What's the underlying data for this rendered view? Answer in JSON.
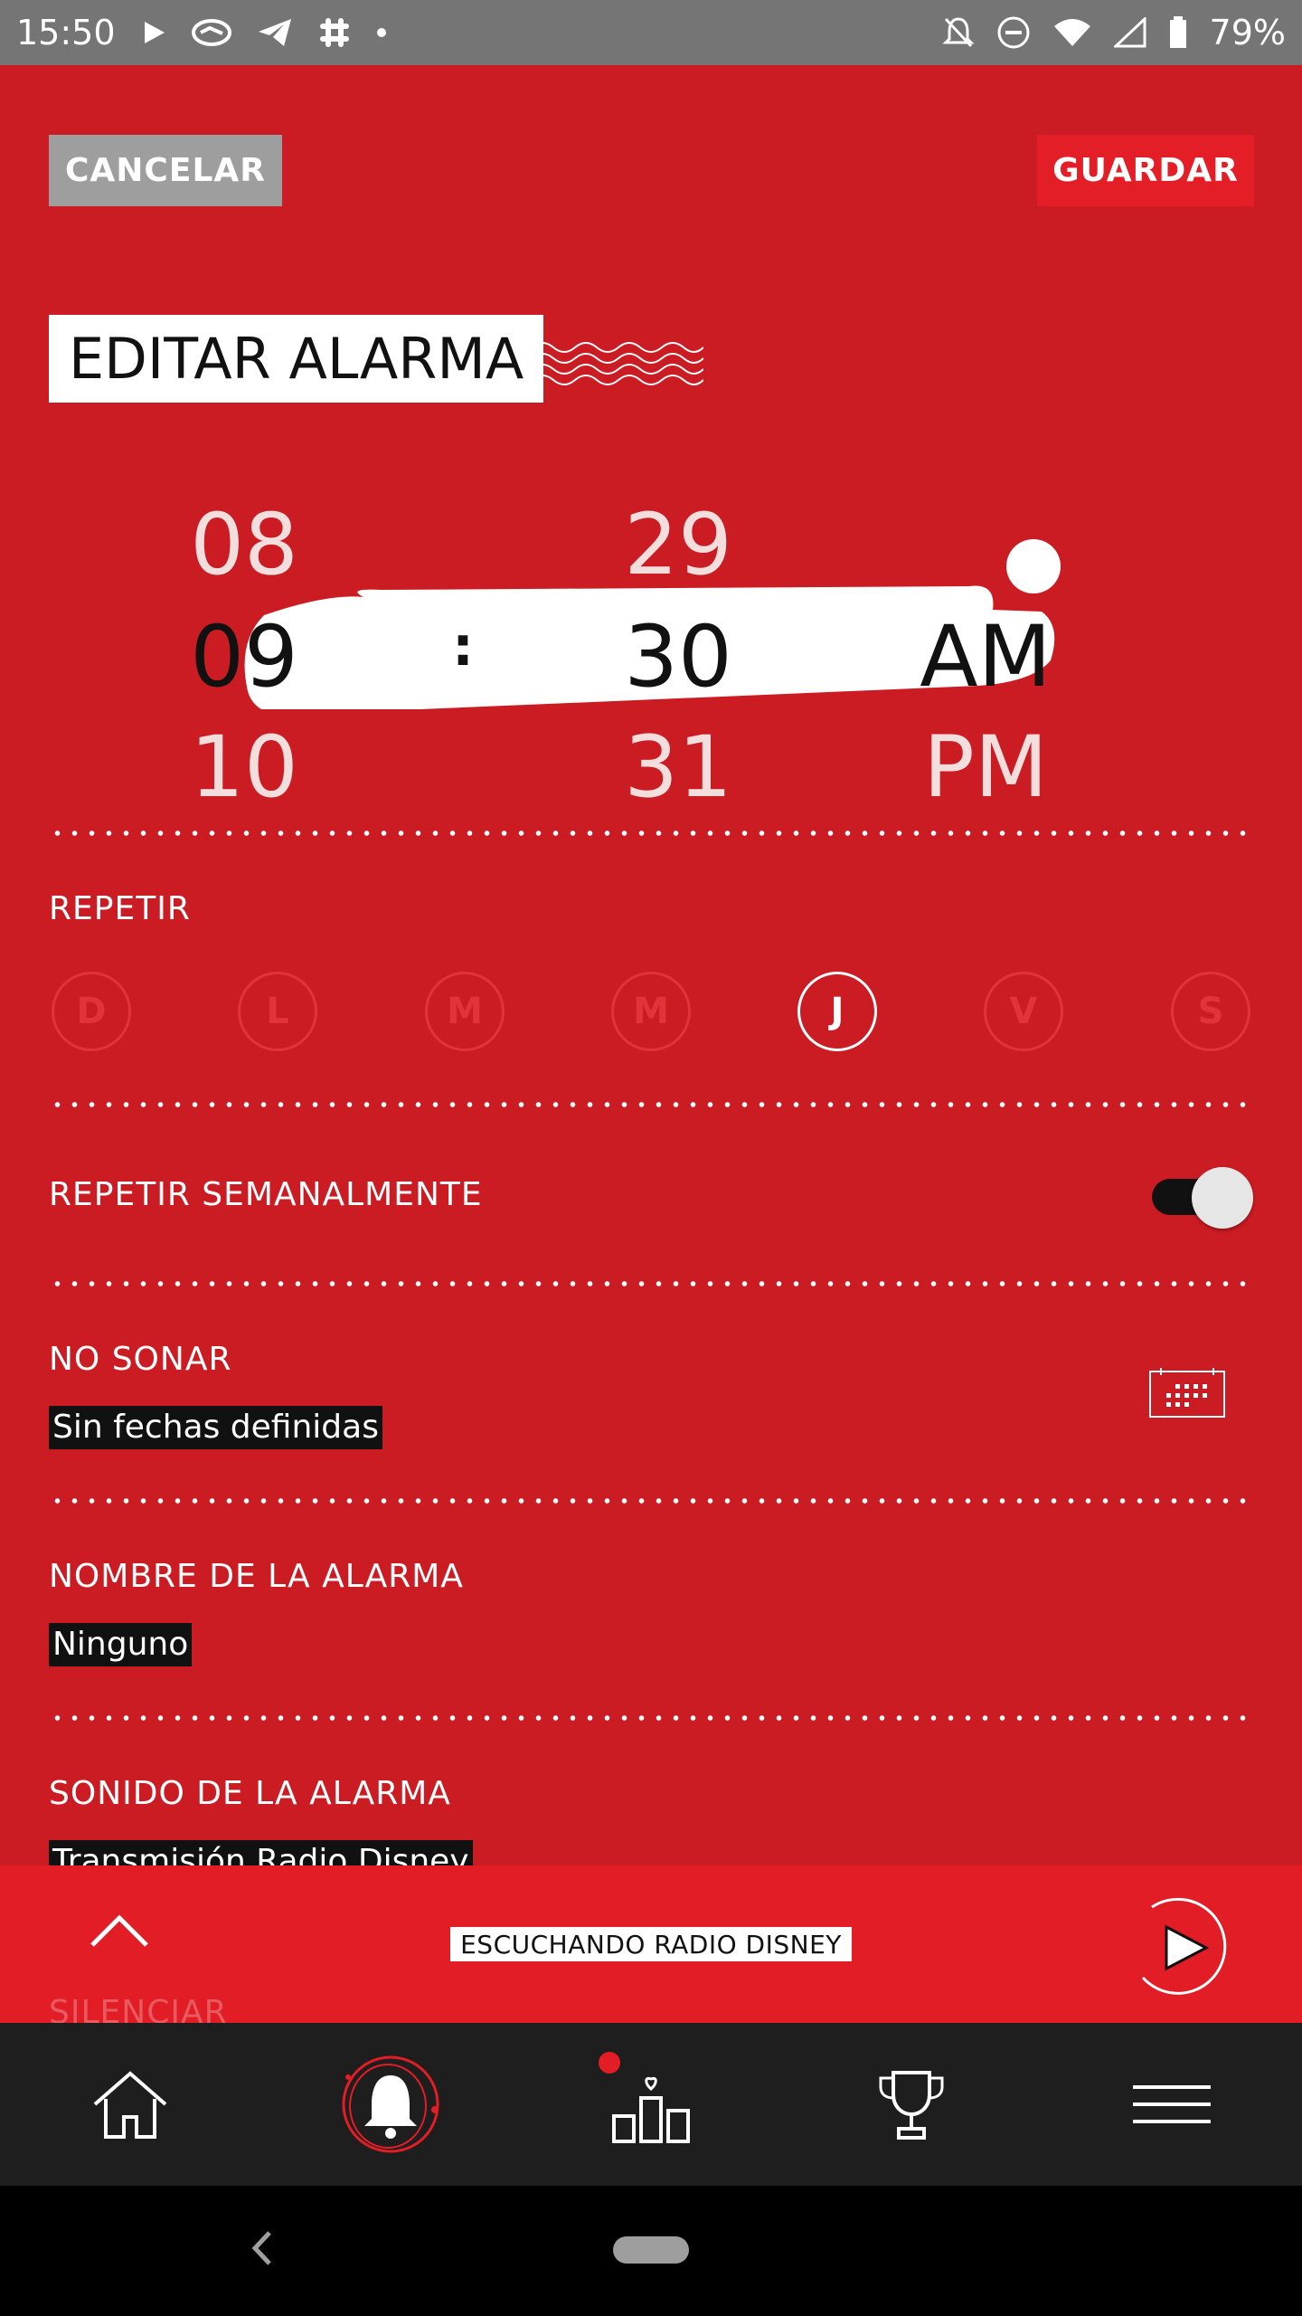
{
  "status_bar": {
    "time": "15:50",
    "battery": "79%",
    "icons": [
      "play-icon",
      "handshake-icon",
      "telegram-icon",
      "slack-icon",
      "dot-icon",
      "bell-off-icon",
      "dnd-icon",
      "wifi-icon",
      "signal-icon",
      "battery-icon"
    ]
  },
  "header": {
    "cancel_label": "CANCELAR",
    "save_label": "GUARDAR",
    "title": "EDITAR ALARMA"
  },
  "picker": {
    "hours": [
      "08",
      "09",
      "10"
    ],
    "minutes": [
      "29",
      "30",
      "31"
    ],
    "meridiem": [
      "AM",
      "PM"
    ],
    "separator": ":",
    "selected": {
      "hour": "09",
      "minute": "30",
      "meridiem": "AM"
    }
  },
  "repeat": {
    "label": "REPETIR",
    "days": [
      {
        "letter": "D",
        "active": false
      },
      {
        "letter": "L",
        "active": false
      },
      {
        "letter": "M",
        "active": false
      },
      {
        "letter": "M",
        "active": false
      },
      {
        "letter": "J",
        "active": true
      },
      {
        "letter": "V",
        "active": false
      },
      {
        "letter": "S",
        "active": false
      }
    ]
  },
  "weekly": {
    "label": "REPETIR SEMANALMENTE",
    "enabled": true
  },
  "no_ring": {
    "label": "NO SONAR",
    "value": "Sin fechas definidas"
  },
  "alarm_name": {
    "label": "NOMBRE DE LA ALARMA",
    "value": "Ninguno"
  },
  "alarm_sound": {
    "label": "SONIDO DE LA ALARMA",
    "value": "Transmisión Radio Disney"
  },
  "silence": {
    "label": "SILENCIAR"
  },
  "player": {
    "now_playing": "ESCUCHANDO RADIO DISNEY"
  },
  "bottom_nav": [
    "home-icon",
    "alarm-bell-icon",
    "ranking-icon",
    "trophy-icon",
    "menu-icon"
  ],
  "colors": {
    "background": "#cc1c23",
    "accent": "#e31d26",
    "nav": "#1e1e1e"
  }
}
